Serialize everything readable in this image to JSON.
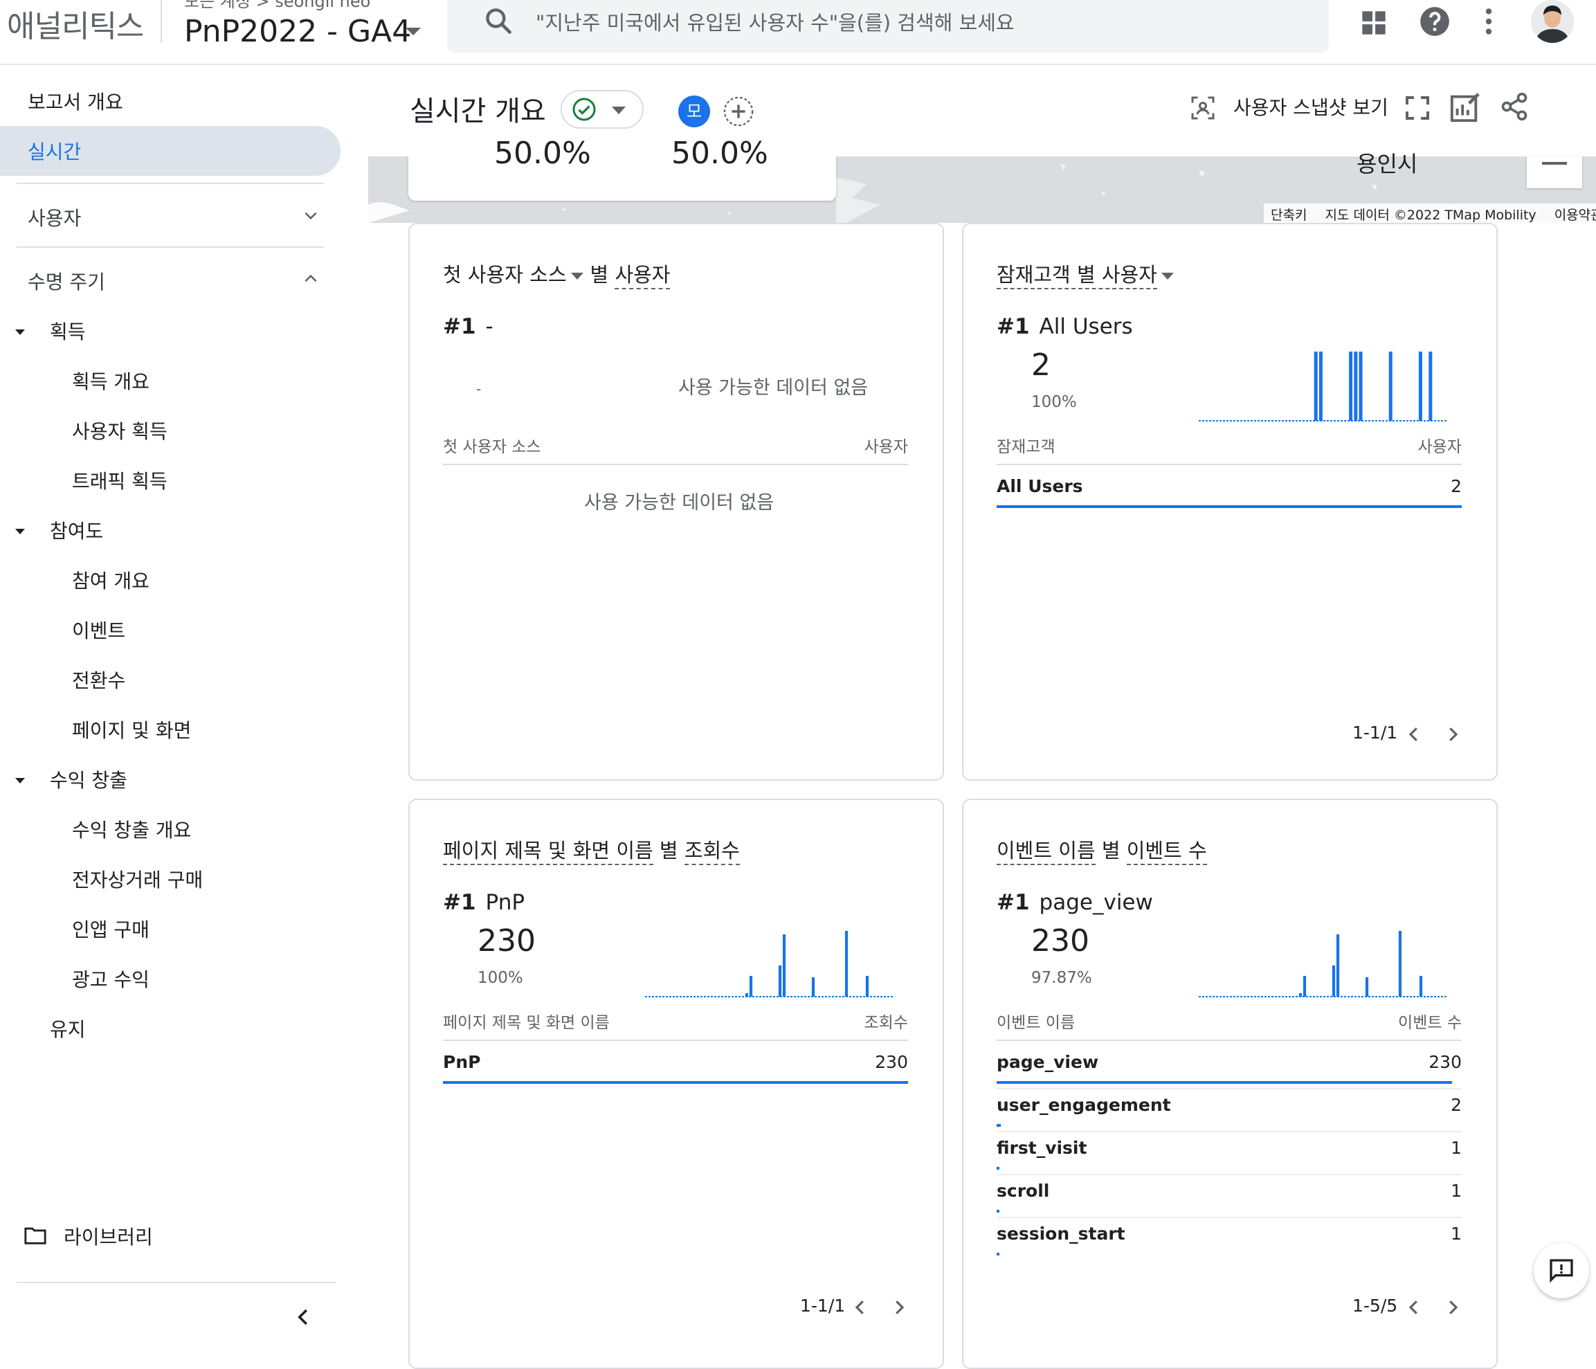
{
  "topbar": {
    "app_name": "애널리틱스",
    "account_crumb": "모든 계정 > seongil heo",
    "property_name": "PnP2022 - GA4",
    "search_placeholder": "\"지난주 미국에서 유입된 사용자 수\"을(를) 검색해 보세요",
    "icons": [
      "search-icon",
      "apps-icon",
      "help-icon",
      "more-vert-icon",
      "avatar"
    ]
  },
  "sidebar": {
    "report_overview": "보고서 개요",
    "realtime": "실시간",
    "user": "사용자",
    "lifecycle": "수명 주기",
    "acquisition": "획득",
    "acquisition_overview": "획득 개요",
    "user_acquisition": "사용자 획득",
    "traffic_acquisition": "트래픽 획득",
    "engagement": "참여도",
    "engagement_overview": "참여 개요",
    "events": "이벤트",
    "conversions": "전환수",
    "pages_screens": "페이지 및 화면",
    "monetization": "수익 창출",
    "monetization_overview": "수익 창출 개요",
    "ecommerce": "전자상거래 구매",
    "in_app": "인앱 구매",
    "ad_revenue": "광고 수익",
    "retention": "유지",
    "library": "라이브러리"
  },
  "header": {
    "title": "실시간 개요",
    "compare_chip": "모",
    "snapshot_label": "사용자 스냅샷 보기"
  },
  "map": {
    "pct1": "50.0%",
    "pct2": "50.0%",
    "city": "용인시",
    "attrib_shortcuts": "단축키",
    "attrib_data": "지도 데이터 ©2022 TMap Mobility",
    "attrib_terms": "이용약관"
  },
  "cards": {
    "first_source": {
      "title_dim": "첫 사용자 소스",
      "title_by": "별",
      "title_metric": "사용자",
      "rank": "#1",
      "rank_label": "-",
      "dash_small": "-",
      "nodata_top": "사용 가능한 데이터 없음",
      "col_left": "첫 사용자 소스",
      "col_right": "사용자",
      "nodata_table": "사용 가능한 데이터 없음"
    },
    "audience": {
      "title": "잠재고객 별 사용자",
      "title_dim": "잠재고객",
      "rank": "#1",
      "rank_label": "All Users",
      "value": "2",
      "pct": "100%",
      "col_left": "잠재고객",
      "col_right": "사용자",
      "rows": [
        {
          "label": "All Users",
          "value": "2",
          "share": 1.0
        }
      ],
      "pager": "1-1/1",
      "spark": [
        0,
        0,
        0,
        0,
        0,
        0,
        0,
        0,
        0,
        0,
        0,
        0,
        0,
        0,
        0,
        0,
        0,
        0,
        0,
        0,
        0,
        0,
        0,
        1,
        1,
        0,
        0,
        0,
        0,
        0,
        1,
        1,
        1,
        0,
        0,
        0,
        0,
        0,
        1,
        0,
        0,
        0,
        0,
        0,
        1,
        0,
        1,
        0,
        0,
        0
      ]
    },
    "pages": {
      "title_dim": "페이지 제목 및 화면 이름",
      "title_by": "별",
      "title_metric": "조회수",
      "rank": "#1",
      "rank_label": "PnP",
      "value": "230",
      "pct": "100%",
      "col_left": "페이지 제목 및 화면 이름",
      "col_right": "조회수",
      "rows": [
        {
          "label": "PnP",
          "value": "230",
          "share": 1.0
        }
      ],
      "pager": "1-1/1",
      "spark": [
        0,
        0,
        0,
        0,
        0,
        0,
        0,
        0,
        0,
        0,
        0,
        0,
        0,
        0,
        0,
        0,
        0,
        0,
        0,
        0,
        0,
        0,
        0,
        0,
        0.05,
        0.3,
        0,
        0,
        0,
        0,
        0,
        0,
        0.45,
        0.9,
        0,
        0,
        0,
        0,
        0,
        0,
        0.28,
        0,
        0,
        0,
        0,
        0,
        0,
        0,
        0.95,
        0,
        0,
        0,
        0,
        0.3,
        0,
        0,
        0,
        0,
        0,
        0
      ]
    },
    "events": {
      "title_dim": "이벤트 이름",
      "title_by": "별",
      "title_metric": "이벤트 수",
      "rank": "#1",
      "rank_label": "page_view",
      "value": "230",
      "pct": "97.87%",
      "col_left": "이벤트 이름",
      "col_right": "이벤트 수",
      "rows": [
        {
          "label": "page_view",
          "value": "230",
          "share": 0.979
        },
        {
          "label": "user_engagement",
          "value": "2",
          "share": 0.009
        },
        {
          "label": "first_visit",
          "value": "1",
          "share": 0.004
        },
        {
          "label": "scroll",
          "value": "1",
          "share": 0.004
        },
        {
          "label": "session_start",
          "value": "1",
          "share": 0.004
        }
      ],
      "pager": "1-5/5",
      "spark": [
        0,
        0,
        0,
        0,
        0,
        0,
        0,
        0,
        0,
        0,
        0,
        0,
        0,
        0,
        0,
        0,
        0,
        0,
        0,
        0,
        0,
        0,
        0,
        0,
        0.05,
        0.3,
        0,
        0,
        0,
        0,
        0,
        0,
        0.45,
        0.9,
        0,
        0,
        0,
        0,
        0,
        0,
        0.28,
        0,
        0,
        0,
        0,
        0,
        0,
        0,
        0.95,
        0,
        0,
        0,
        0,
        0.3,
        0,
        0,
        0,
        0,
        0,
        0
      ]
    }
  },
  "colors": {
    "accent": "#1a73e8",
    "active_nav": "#dde3ea",
    "check": "#188038"
  }
}
